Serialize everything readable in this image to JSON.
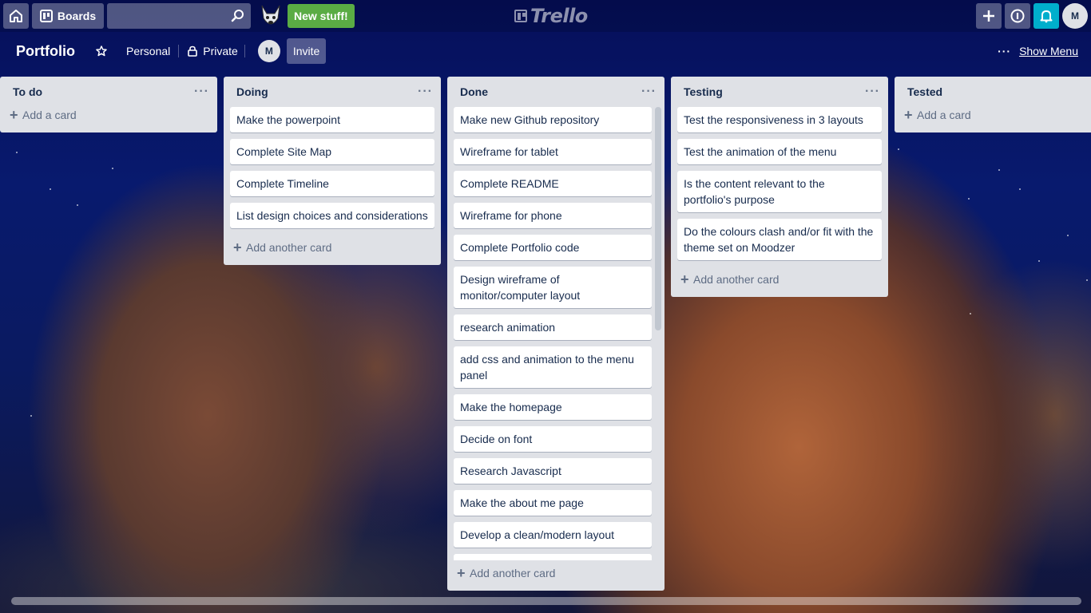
{
  "header": {
    "boards_label": "Boards",
    "new_stuff_label": "New stuff!",
    "logo_text": "Trello",
    "account_initial": "M"
  },
  "board": {
    "name": "Portfolio",
    "team_label": "Personal",
    "visibility_label": "Private",
    "member_initial": "M",
    "invite_label": "Invite",
    "show_menu_label": "Show Menu"
  },
  "lists": [
    {
      "title": "To do",
      "cards": [],
      "add_label": "Add a card"
    },
    {
      "title": "Doing",
      "cards": [
        "Make the powerpoint",
        "Complete Site Map",
        "Complete Timeline",
        "List design choices and considerations"
      ],
      "add_label": "Add another card"
    },
    {
      "title": "Done",
      "cards": [
        "Make new Github repository",
        "Wireframe for tablet",
        "Complete README",
        "Wireframe for phone",
        "Complete Portfolio code",
        "Design wireframe of monitor/computer layout",
        "research animation",
        "add css and animation to the menu panel",
        "Make the homepage",
        "Decide on font",
        "Research Javascript",
        "Make the about me page",
        "Develop a clean/modern layout"
      ],
      "add_label": "Add another card"
    },
    {
      "title": "Testing",
      "cards": [
        "Test the responsiveness in 3 layouts",
        "Test the animation of the menu",
        "Is the content relevant to the portfolio's purpose",
        "Do the colours clash and/or fit with the theme set on Moodzer"
      ],
      "add_label": "Add another card"
    },
    {
      "title": "Tested",
      "cards": [],
      "add_label": "Add a card"
    }
  ],
  "icons": {
    "home": "home-icon",
    "boards": "boards-icon",
    "search": "search-icon",
    "add": "plus-icon",
    "info": "info-icon",
    "notifications": "bell-icon",
    "star": "star-icon",
    "lock": "lock-icon",
    "more": "ellipsis-icon"
  }
}
